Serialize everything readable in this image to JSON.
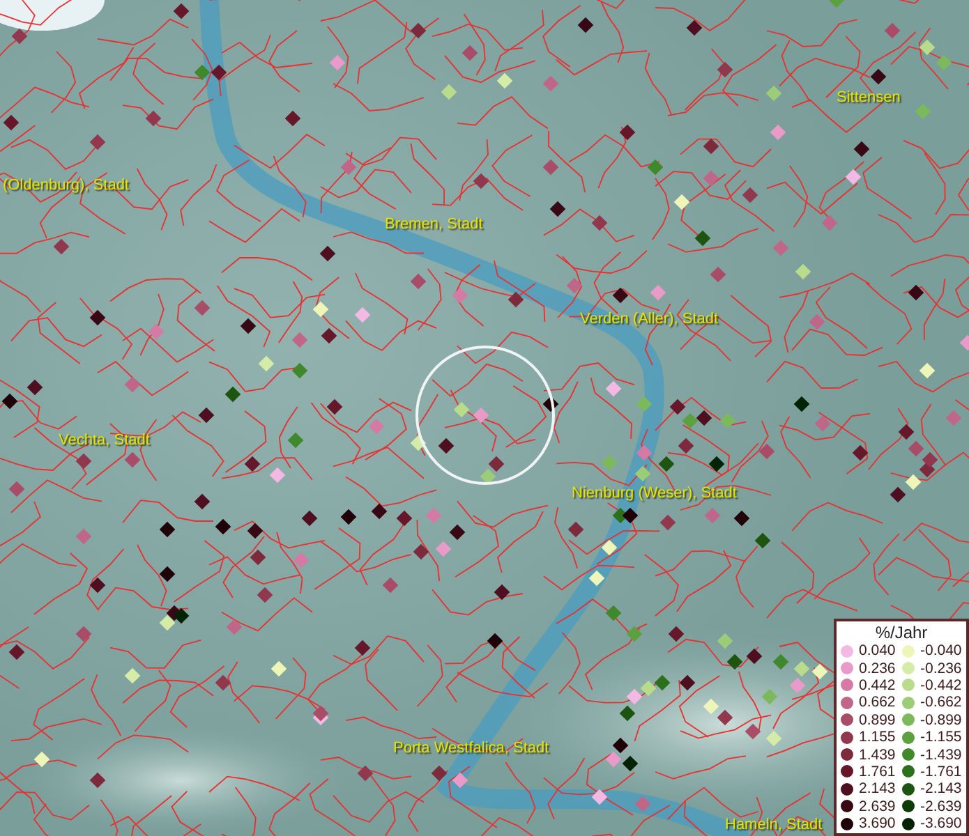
{
  "map": {
    "place_labels": [
      "(Oldenburg), Stadt",
      "Bremen, Stadt",
      "Sittensen",
      "Verden (Aller), Stadt",
      "Vechta, Stadt",
      "Nienburg (Weser), Stadt",
      "Porta Westfalica, Stadt",
      "Hameln, Stadt"
    ]
  },
  "legend": {
    "title": "%/Jahr",
    "positive": [
      {
        "label": "0.040",
        "color": "#f4b8e4"
      },
      {
        "label": "0.236",
        "color": "#e89ac8"
      },
      {
        "label": "0.442",
        "color": "#d47aa4"
      },
      {
        "label": "0.662",
        "color": "#c06688"
      },
      {
        "label": "0.899",
        "color": "#a84c68"
      },
      {
        "label": "1.155",
        "color": "#92384e"
      },
      {
        "label": "1.439",
        "color": "#7c2a3c"
      },
      {
        "label": "1.761",
        "color": "#66182a"
      },
      {
        "label": "2.143",
        "color": "#4e1020"
      },
      {
        "label": "2.639",
        "color": "#380814"
      },
      {
        "label": "3.690",
        "color": "#200008"
      }
    ],
    "negative": [
      {
        "label": "-0.040",
        "color": "#eef5b8"
      },
      {
        "label": "-0.236",
        "color": "#d4eca8"
      },
      {
        "label": "-0.442",
        "color": "#b8dc8c"
      },
      {
        "label": "-0.662",
        "color": "#9ccc78"
      },
      {
        "label": "-0.899",
        "color": "#7cb85c"
      },
      {
        "label": "-1.155",
        "color": "#5ca040"
      },
      {
        "label": "-1.439",
        "color": "#40882c"
      },
      {
        "label": "-1.761",
        "color": "#2c701c"
      },
      {
        "label": "-2.143",
        "color": "#1c5410"
      },
      {
        "label": "-2.639",
        "color": "#0c3c08"
      },
      {
        "label": "-3.690",
        "color": "#022404"
      }
    ]
  }
}
